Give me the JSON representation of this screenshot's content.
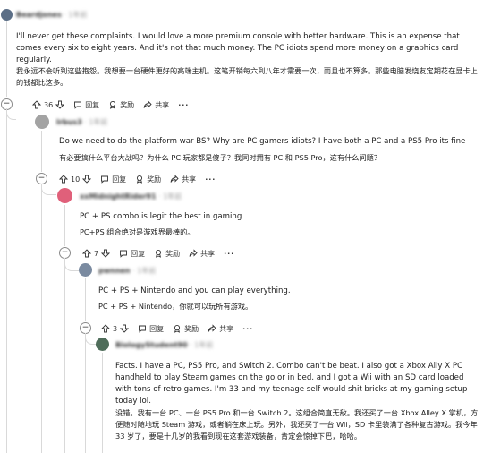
{
  "comments": [
    {
      "id": "c1",
      "user": "Beardjones",
      "time": "· 1年前",
      "en": "I'll never get these complaints. I would love a more premium console with better hardware. This is an expense that comes every six to eight years. And it's not that much money. The PC idiots spend more money on a graphics card regularly.",
      "cn": "我永远不会听到这些抱怨。我想要一台硬件更好的高端主机。这笔开销每六到八年才需要一次，而且也不算多。那些电脑发烧友定期花在显卡上的钱都比这多。",
      "votes": "36",
      "reply": "回复",
      "award": "奖励",
      "share": "共享"
    },
    {
      "id": "c2",
      "user": "Irbus3",
      "time": "· 1年前",
      "en": "Do we need to do the platform war BS? Why are PC gamers idiots? I have both a PC and a PS5 Pro its fine",
      "cn": "有必要搞什么平台大战吗？为什么 PC 玩家都是傻子？我同时拥有 PC 和 PS5 Pro，这有什么问题？",
      "votes": "10",
      "reply": "回复",
      "award": "奖励",
      "share": "共享"
    },
    {
      "id": "c3",
      "user": "xxMidnightRider91",
      "time": "· 1年前",
      "en": "PC + PS combo is legit the best in gaming",
      "cn": "PC+PS 组合绝对是游戏界最棒的。",
      "votes": "7",
      "reply": "回复",
      "award": "奖励",
      "share": "共享"
    },
    {
      "id": "c4",
      "user": "pwnnen",
      "time": "· 1年前",
      "en": "PC + PS + Nintendo and you can play everything.",
      "cn": "PC + PS + Nintendo，你就可以玩所有游戏。",
      "votes": "3",
      "reply": "回复",
      "award": "奖励",
      "share": "共享"
    },
    {
      "id": "c5",
      "user": "BiologyStudent90",
      "time": "· 1年前",
      "en": "Facts. I have a PC, PS5 Pro, and Switch 2. Combo can't be beat. I also got a Xbox Ally X PC handheld to play Steam games on the go or in bed, and I got a Wii with an SD card loaded with tons of retro games. I'm 33 and my teenage self would shit bricks at my gaming setup today lol.",
      "cn": "没错。我有一台 PC、一台 PS5 Pro 和一台 Switch 2。这组合简直无敌。我还买了一台 Xbox Alley X 掌机，方便随时随地玩 Steam 游戏，或者躺在床上玩。另外，我还买了一台 Wii，SD 卡里装满了各种复古游戏。我今年 33 岁了，要是十几岁的我看到现在这套游戏装备，肯定会惊掉下巴，哈哈。"
    }
  ],
  "colors": {
    "avatar1": "#5b6e86",
    "avatar2": "#a3a3a3",
    "avatar3": "#e0607a",
    "avatar4": "#7a8aa0",
    "avatar5": "#4f6d5a"
  }
}
